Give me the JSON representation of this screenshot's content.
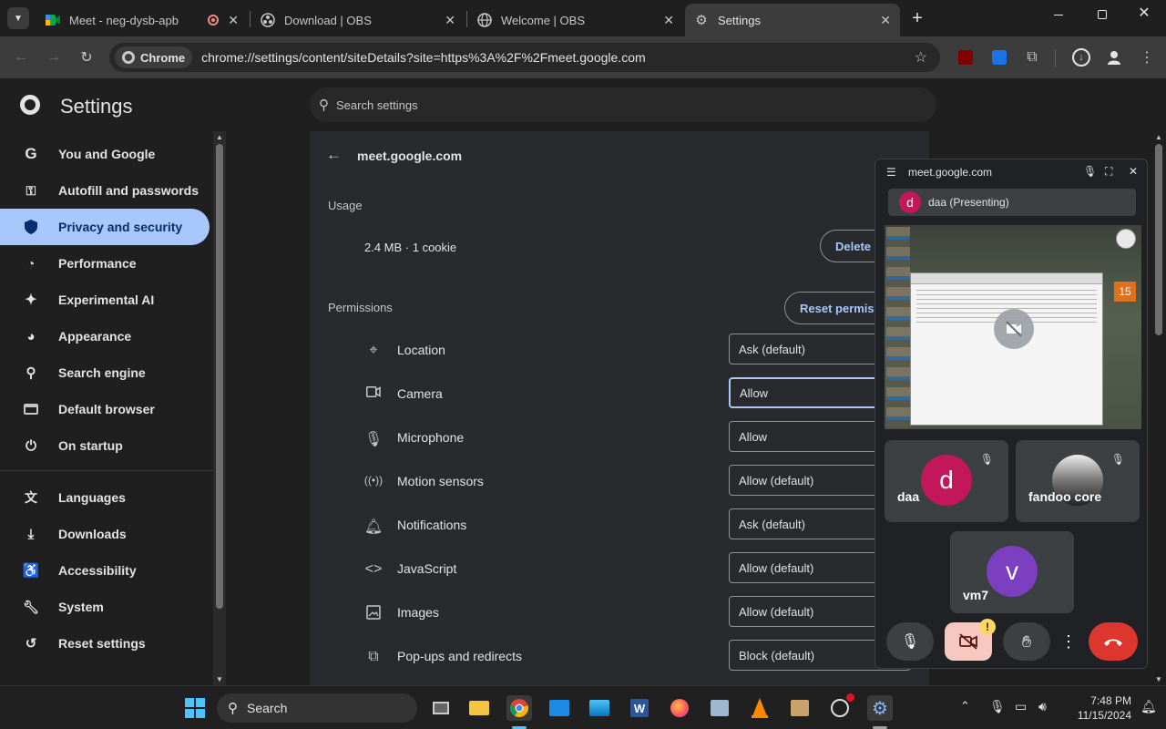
{
  "tabs": [
    {
      "title": "Meet - neg-dysb-apb"
    },
    {
      "title": "Download | OBS"
    },
    {
      "title": "Welcome | OBS"
    },
    {
      "title": "Settings"
    }
  ],
  "toolbar": {
    "chip_label": "Chrome",
    "url": "chrome://settings/content/siteDetails?site=https%3A%2F%2Fmeet.google.com"
  },
  "settings": {
    "title": "Settings",
    "search_placeholder": "Search settings",
    "nav": [
      {
        "label": "You and Google",
        "icon": "google-icon"
      },
      {
        "label": "Autofill and passwords",
        "icon": "key-icon"
      },
      {
        "label": "Privacy and security",
        "icon": "shield-icon",
        "selected": true
      },
      {
        "label": "Performance",
        "icon": "gauge-icon"
      },
      {
        "label": "Experimental AI",
        "icon": "sparkle-icon"
      },
      {
        "label": "Appearance",
        "icon": "palette-icon"
      },
      {
        "label": "Search engine",
        "icon": "search-icon"
      },
      {
        "label": "Default browser",
        "icon": "browser-icon"
      },
      {
        "label": "On startup",
        "icon": "power-icon"
      },
      {
        "label": "Languages",
        "icon": "translate-icon"
      },
      {
        "label": "Downloads",
        "icon": "download-icon"
      },
      {
        "label": "Accessibility",
        "icon": "accessibility-icon"
      },
      {
        "label": "System",
        "icon": "wrench-icon"
      },
      {
        "label": "Reset settings",
        "icon": "reset-icon"
      }
    ],
    "site": "meet.google.com",
    "usage_heading": "Usage",
    "usage_value": "2.4 MB · 1 cookie",
    "delete_button": "Delete data",
    "permissions_heading": "Permissions",
    "reset_button": "Reset permissions",
    "permissions": [
      {
        "label": "Location",
        "value": "Ask (default)",
        "icon": "location-icon"
      },
      {
        "label": "Camera",
        "value": "Allow",
        "icon": "camera-icon"
      },
      {
        "label": "Microphone",
        "value": "Allow",
        "icon": "microphone-icon"
      },
      {
        "label": "Motion sensors",
        "value": "Allow (default)",
        "icon": "motion-sensor-icon"
      },
      {
        "label": "Notifications",
        "value": "Ask (default)",
        "icon": "bell-icon"
      },
      {
        "label": "JavaScript",
        "value": "Allow (default)",
        "icon": "code-icon"
      },
      {
        "label": "Images",
        "value": "Allow (default)",
        "icon": "image-icon"
      },
      {
        "label": "Pop-ups and redirects",
        "value": "Block (default)",
        "icon": "popup-icon"
      }
    ]
  },
  "pip": {
    "site": "meet.google.com",
    "presenting_label": "daa (Presenting)",
    "presenting_initial": "d",
    "shared_screen_badge": "15",
    "participants": [
      {
        "name": "daa",
        "initial": "d",
        "color": "#c2185b"
      },
      {
        "name": "fandoo core",
        "initial": "",
        "color": "#555555"
      },
      {
        "name": "vm7",
        "initial": "v",
        "color": "#7b3fbf"
      }
    ]
  },
  "taskbar": {
    "search_label": "Search",
    "time": "7:48 PM",
    "date": "11/15/2024"
  }
}
